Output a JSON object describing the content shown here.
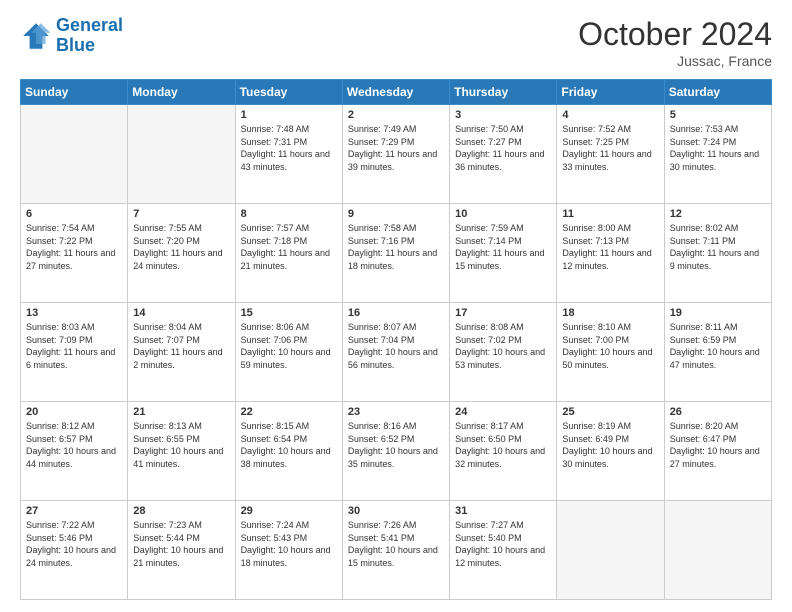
{
  "header": {
    "logo_line1": "General",
    "logo_line2": "Blue",
    "month_title": "October 2024",
    "location": "Jussac, France"
  },
  "weekdays": [
    "Sunday",
    "Monday",
    "Tuesday",
    "Wednesday",
    "Thursday",
    "Friday",
    "Saturday"
  ],
  "weeks": [
    [
      {
        "day": "",
        "empty": true
      },
      {
        "day": "",
        "empty": true
      },
      {
        "day": "1",
        "sunrise": "7:48 AM",
        "sunset": "7:31 PM",
        "daylight": "11 hours and 43 minutes."
      },
      {
        "day": "2",
        "sunrise": "7:49 AM",
        "sunset": "7:29 PM",
        "daylight": "11 hours and 39 minutes."
      },
      {
        "day": "3",
        "sunrise": "7:50 AM",
        "sunset": "7:27 PM",
        "daylight": "11 hours and 36 minutes."
      },
      {
        "day": "4",
        "sunrise": "7:52 AM",
        "sunset": "7:25 PM",
        "daylight": "11 hours and 33 minutes."
      },
      {
        "day": "5",
        "sunrise": "7:53 AM",
        "sunset": "7:24 PM",
        "daylight": "11 hours and 30 minutes."
      }
    ],
    [
      {
        "day": "6",
        "sunrise": "7:54 AM",
        "sunset": "7:22 PM",
        "daylight": "11 hours and 27 minutes."
      },
      {
        "day": "7",
        "sunrise": "7:55 AM",
        "sunset": "7:20 PM",
        "daylight": "11 hours and 24 minutes."
      },
      {
        "day": "8",
        "sunrise": "7:57 AM",
        "sunset": "7:18 PM",
        "daylight": "11 hours and 21 minutes."
      },
      {
        "day": "9",
        "sunrise": "7:58 AM",
        "sunset": "7:16 PM",
        "daylight": "11 hours and 18 minutes."
      },
      {
        "day": "10",
        "sunrise": "7:59 AM",
        "sunset": "7:14 PM",
        "daylight": "11 hours and 15 minutes."
      },
      {
        "day": "11",
        "sunrise": "8:00 AM",
        "sunset": "7:13 PM",
        "daylight": "11 hours and 12 minutes."
      },
      {
        "day": "12",
        "sunrise": "8:02 AM",
        "sunset": "7:11 PM",
        "daylight": "11 hours and 9 minutes."
      }
    ],
    [
      {
        "day": "13",
        "sunrise": "8:03 AM",
        "sunset": "7:09 PM",
        "daylight": "11 hours and 6 minutes."
      },
      {
        "day": "14",
        "sunrise": "8:04 AM",
        "sunset": "7:07 PM",
        "daylight": "11 hours and 2 minutes."
      },
      {
        "day": "15",
        "sunrise": "8:06 AM",
        "sunset": "7:06 PM",
        "daylight": "10 hours and 59 minutes."
      },
      {
        "day": "16",
        "sunrise": "8:07 AM",
        "sunset": "7:04 PM",
        "daylight": "10 hours and 56 minutes."
      },
      {
        "day": "17",
        "sunrise": "8:08 AM",
        "sunset": "7:02 PM",
        "daylight": "10 hours and 53 minutes."
      },
      {
        "day": "18",
        "sunrise": "8:10 AM",
        "sunset": "7:00 PM",
        "daylight": "10 hours and 50 minutes."
      },
      {
        "day": "19",
        "sunrise": "8:11 AM",
        "sunset": "6:59 PM",
        "daylight": "10 hours and 47 minutes."
      }
    ],
    [
      {
        "day": "20",
        "sunrise": "8:12 AM",
        "sunset": "6:57 PM",
        "daylight": "10 hours and 44 minutes."
      },
      {
        "day": "21",
        "sunrise": "8:13 AM",
        "sunset": "6:55 PM",
        "daylight": "10 hours and 41 minutes."
      },
      {
        "day": "22",
        "sunrise": "8:15 AM",
        "sunset": "6:54 PM",
        "daylight": "10 hours and 38 minutes."
      },
      {
        "day": "23",
        "sunrise": "8:16 AM",
        "sunset": "6:52 PM",
        "daylight": "10 hours and 35 minutes."
      },
      {
        "day": "24",
        "sunrise": "8:17 AM",
        "sunset": "6:50 PM",
        "daylight": "10 hours and 32 minutes."
      },
      {
        "day": "25",
        "sunrise": "8:19 AM",
        "sunset": "6:49 PM",
        "daylight": "10 hours and 30 minutes."
      },
      {
        "day": "26",
        "sunrise": "8:20 AM",
        "sunset": "6:47 PM",
        "daylight": "10 hours and 27 minutes."
      }
    ],
    [
      {
        "day": "27",
        "sunrise": "7:22 AM",
        "sunset": "5:46 PM",
        "daylight": "10 hours and 24 minutes."
      },
      {
        "day": "28",
        "sunrise": "7:23 AM",
        "sunset": "5:44 PM",
        "daylight": "10 hours and 21 minutes."
      },
      {
        "day": "29",
        "sunrise": "7:24 AM",
        "sunset": "5:43 PM",
        "daylight": "10 hours and 18 minutes."
      },
      {
        "day": "30",
        "sunrise": "7:26 AM",
        "sunset": "5:41 PM",
        "daylight": "10 hours and 15 minutes."
      },
      {
        "day": "31",
        "sunrise": "7:27 AM",
        "sunset": "5:40 PM",
        "daylight": "10 hours and 12 minutes."
      },
      {
        "day": "",
        "empty": true
      },
      {
        "day": "",
        "empty": true
      }
    ]
  ]
}
